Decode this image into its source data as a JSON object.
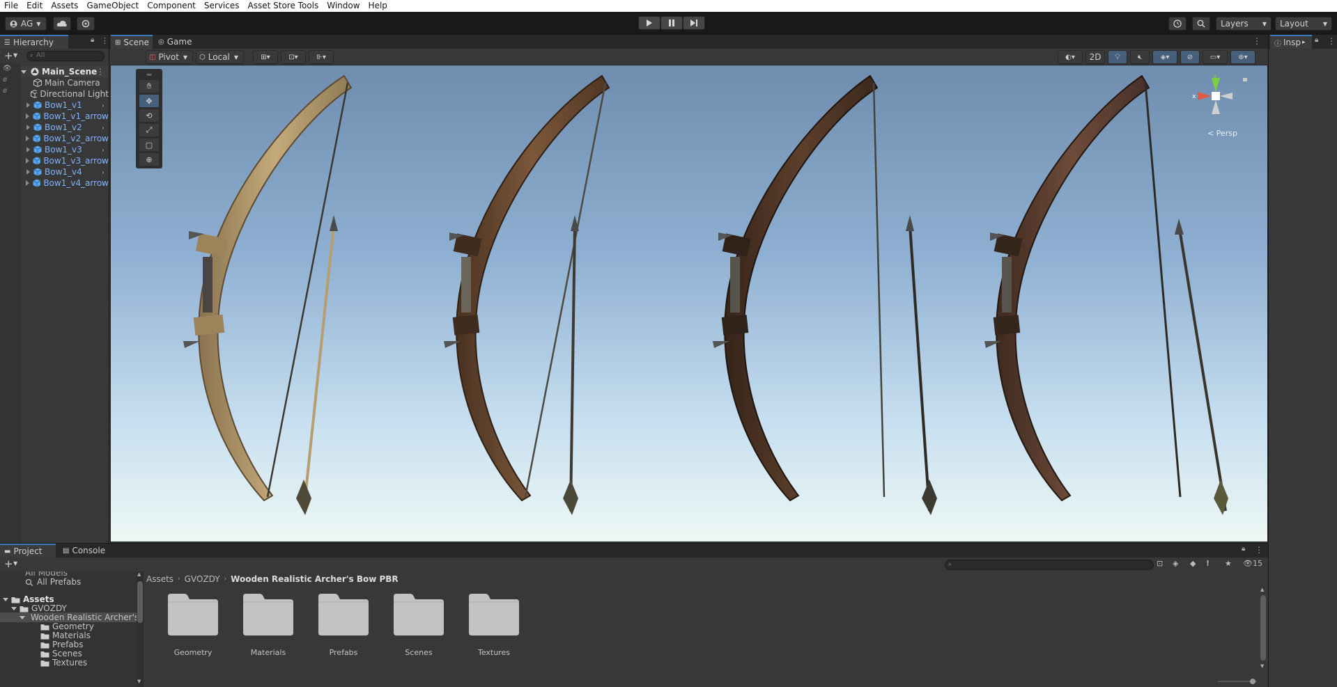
{
  "menu": [
    "File",
    "Edit",
    "Assets",
    "GameObject",
    "Component",
    "Services",
    "Asset Store Tools",
    "Window",
    "Help"
  ],
  "toolbar": {
    "account": "AG",
    "layers": "Layers",
    "layout": "Layout"
  },
  "hierarchy": {
    "tab": "Hierarchy",
    "search_placeholder": "All",
    "scene": "Main_Scene",
    "items": [
      {
        "label": "Main Camera",
        "prefab": false
      },
      {
        "label": "Directional Light",
        "prefab": false
      },
      {
        "label": "Bow1_v1",
        "prefab": true
      },
      {
        "label": "Bow1_v1_arrow",
        "prefab": true
      },
      {
        "label": "Bow1_v2",
        "prefab": true
      },
      {
        "label": "Bow1_v2_arrow",
        "prefab": true
      },
      {
        "label": "Bow1_v3",
        "prefab": true
      },
      {
        "label": "Bow1_v3_arrow",
        "prefab": true
      },
      {
        "label": "Bow1_v4",
        "prefab": true
      },
      {
        "label": "Bow1_v4_arrow",
        "prefab": true
      }
    ]
  },
  "scene": {
    "tabs": [
      "Scene",
      "Game"
    ],
    "pivot": "Pivot",
    "local": "Local",
    "mode_2d": "2D",
    "gizmo_persp": "Persp",
    "gizmo_x": "x",
    "gizmo_y": "y"
  },
  "inspector": {
    "tab": "Insp"
  },
  "project": {
    "tabs": [
      "Project",
      "Console"
    ],
    "count": "15",
    "tree_clipped": "All Models",
    "tree": [
      {
        "label": "All Prefabs"
      },
      {
        "label": "Assets"
      },
      {
        "label": "GVOZDY"
      },
      {
        "label": "Wooden Realistic Archer's Bow PBR"
      },
      {
        "label": "Geometry"
      },
      {
        "label": "Materials"
      },
      {
        "label": "Prefabs"
      },
      {
        "label": "Scenes"
      },
      {
        "label": "Textures"
      }
    ],
    "breadcrumb": [
      "Assets",
      "GVOZDY",
      "Wooden Realistic Archer's Bow PBR"
    ],
    "folders": [
      "Geometry",
      "Materials",
      "Prefabs",
      "Scenes",
      "Textures"
    ]
  },
  "colors": {
    "accent": "#3a79bb",
    "prefab_text": "#7fb2ff",
    "bow_tints": [
      "#b3986a",
      "#6b4a33",
      "#4e3526",
      "#5b3e30"
    ]
  }
}
